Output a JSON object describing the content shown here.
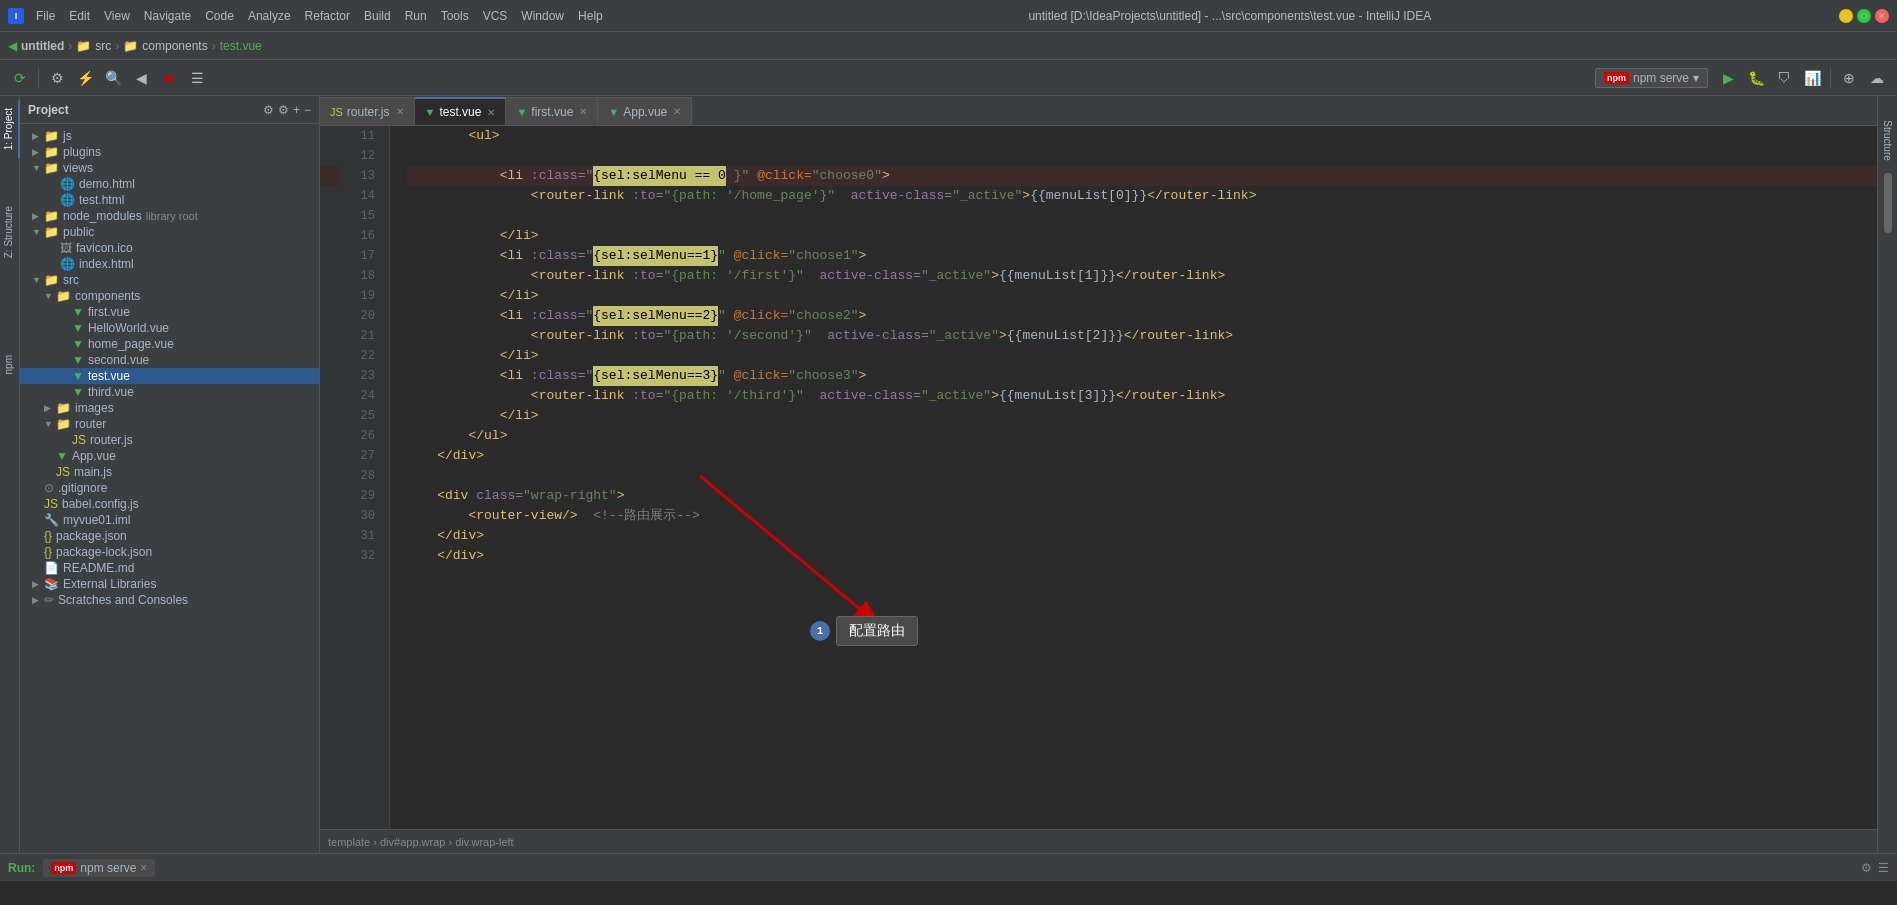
{
  "titlebar": {
    "title": "untitled [D:\\IdeaProjects\\untitled] - ...\\src\\components\\test.vue - IntelliJ IDEA",
    "app_name": "IntelliJ IDEA",
    "menus": [
      "File",
      "Edit",
      "View",
      "Navigate",
      "Code",
      "Analyze",
      "Refactor",
      "Build",
      "Run",
      "Tools",
      "VCS",
      "Window",
      "Help"
    ]
  },
  "breadcrumb": {
    "items": [
      "untitled",
      "src",
      "components",
      "test.vue"
    ]
  },
  "toolbar": {
    "run_config": "npm serve"
  },
  "project_panel": {
    "title": "Project",
    "tree": [
      {
        "level": 0,
        "type": "folder",
        "name": "js",
        "expanded": false
      },
      {
        "level": 0,
        "type": "folder",
        "name": "plugins",
        "expanded": false
      },
      {
        "level": 0,
        "type": "folder",
        "name": "views",
        "expanded": true
      },
      {
        "level": 1,
        "type": "html",
        "name": "demo.html"
      },
      {
        "level": 1,
        "type": "html",
        "name": "test.html"
      },
      {
        "level": 0,
        "type": "folder",
        "name": "node_modules",
        "extra": "library root",
        "expanded": false
      },
      {
        "level": 0,
        "type": "folder",
        "name": "public",
        "expanded": true
      },
      {
        "level": 1,
        "type": "ico",
        "name": "favicon.ico"
      },
      {
        "level": 1,
        "type": "html",
        "name": "index.html"
      },
      {
        "level": 0,
        "type": "folder",
        "name": "src",
        "expanded": true
      },
      {
        "level": 1,
        "type": "folder",
        "name": "components",
        "expanded": true
      },
      {
        "level": 2,
        "type": "vue",
        "name": "first.vue"
      },
      {
        "level": 2,
        "type": "vue",
        "name": "HelloWorld.vue"
      },
      {
        "level": 2,
        "type": "vue",
        "name": "home_page.vue"
      },
      {
        "level": 2,
        "type": "vue",
        "name": "second.vue"
      },
      {
        "level": 2,
        "type": "vue",
        "name": "test.vue",
        "selected": true
      },
      {
        "level": 2,
        "type": "vue",
        "name": "third.vue"
      },
      {
        "level": 1,
        "type": "folder",
        "name": "images",
        "expanded": false
      },
      {
        "level": 1,
        "type": "folder",
        "name": "router",
        "expanded": true
      },
      {
        "level": 2,
        "type": "js",
        "name": "router.js"
      },
      {
        "level": 1,
        "type": "vue",
        "name": "App.vue"
      },
      {
        "level": 1,
        "type": "js",
        "name": "main.js"
      },
      {
        "level": 0,
        "type": "git",
        "name": ".gitignore"
      },
      {
        "level": 0,
        "type": "js",
        "name": "babel.config.js"
      },
      {
        "level": 0,
        "type": "iml",
        "name": "myvue01.iml"
      },
      {
        "level": 0,
        "type": "json",
        "name": "package.json"
      },
      {
        "level": 0,
        "type": "json",
        "name": "package-lock.json"
      },
      {
        "level": 0,
        "type": "md",
        "name": "README.md"
      },
      {
        "level": 0,
        "type": "lib",
        "name": "External Libraries"
      },
      {
        "level": 0,
        "type": "scratches",
        "name": "Scratches and Consoles"
      }
    ]
  },
  "tabs": [
    {
      "name": "router.js",
      "type": "js",
      "active": false
    },
    {
      "name": "test.vue",
      "type": "vue",
      "active": true
    },
    {
      "name": "first.vue",
      "type": "vue",
      "active": false
    },
    {
      "name": "App.vue",
      "type": "vue",
      "active": false
    }
  ],
  "code_lines": [
    {
      "num": 11,
      "indent": 8,
      "content": "<ul>"
    },
    {
      "num": 12,
      "indent": 0,
      "content": ""
    },
    {
      "num": 13,
      "indent": 12,
      "content": "<li :class=\"{sel:selMenu == 0 }\" @click=\"choose0\">"
    },
    {
      "num": 14,
      "indent": 16,
      "content": "<router-link :to=\"{path: '/home_page'}\"  active-class=\"_active\">{{menuList[0]}}</router-link>"
    },
    {
      "num": 15,
      "indent": 0,
      "content": ""
    },
    {
      "num": 16,
      "indent": 12,
      "content": "</li>"
    },
    {
      "num": 17,
      "indent": 12,
      "content": "<li :class=\"{sel:selMenu==1}\" @click=\"choose1\">"
    },
    {
      "num": 18,
      "indent": 16,
      "content": "<router-link :to=\"{path: '/first'}\"  active-class=\"_active\">{{menuList[1]}}</router-link>"
    },
    {
      "num": 19,
      "indent": 12,
      "content": "</li>"
    },
    {
      "num": 20,
      "indent": 12,
      "content": "<li :class=\"{sel:selMenu==2}\" @click=\"choose2\">"
    },
    {
      "num": 21,
      "indent": 16,
      "content": "<router-link :to=\"{path: '/second'}\"  active-class=\"_active\">{{menuList[2]}}</router-link>"
    },
    {
      "num": 22,
      "indent": 12,
      "content": "</li>"
    },
    {
      "num": 23,
      "indent": 12,
      "content": "<li :class=\"{sel:selMenu==3}\" @click=\"choose3\">"
    },
    {
      "num": 24,
      "indent": 16,
      "content": "<router-link :to=\"{path: '/third'}\"  active-class=\"_active\">{{menuList[3]}}</router-link>"
    },
    {
      "num": 25,
      "indent": 12,
      "content": "</li>"
    },
    {
      "num": 26,
      "indent": 8,
      "content": "</ul>"
    },
    {
      "num": 27,
      "indent": 4,
      "content": "</div>"
    },
    {
      "num": 28,
      "indent": 0,
      "content": ""
    },
    {
      "num": 29,
      "indent": 4,
      "content": "<div class=\"wrap-right\">"
    },
    {
      "num": 30,
      "indent": 8,
      "content": "<router-view/>  <!--路由展示-->"
    },
    {
      "num": 31,
      "indent": 4,
      "content": "</div>"
    },
    {
      "num": 32,
      "indent": 4,
      "content": "</div>"
    }
  ],
  "status_bar": {
    "path": "template › div#app.wrap › div.wrap-left"
  },
  "bottom_bar": {
    "run_label": "Run:",
    "run_config": "npm serve",
    "close": "×"
  },
  "annotation": {
    "tooltip_text": "配置路由",
    "tooltip_num": "1"
  },
  "colors": {
    "accent": "#4a6ea8",
    "background": "#2b2b2b",
    "panel": "#3c3f41",
    "vue_green": "#4caf50",
    "js_yellow": "#cbcb41"
  }
}
